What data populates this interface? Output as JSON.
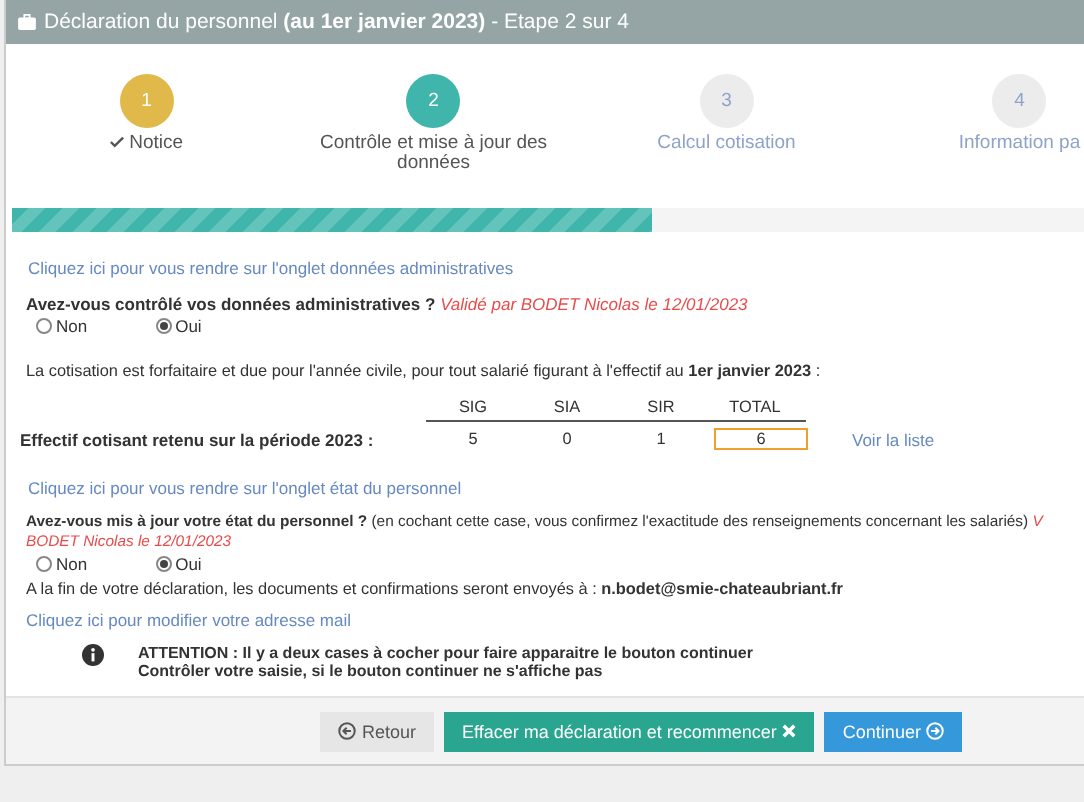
{
  "window": {
    "title": "Déclaration du personnel **(au 1er janvier 2023)** - Etape 2 sur 4"
  },
  "steps": [
    {
      "number": "1",
      "label": "Notice",
      "completed": true,
      "selected": false
    },
    {
      "number": "2",
      "label": "Contrôle et mise à jour des données",
      "completed": false,
      "selected": true
    },
    {
      "number": "3",
      "label": "Calcul cotisation",
      "completed": false,
      "selected": false
    },
    {
      "number": "4",
      "label": "Information pa",
      "completed": false,
      "selected": false
    }
  ],
  "progress": {
    "level": 0.555
  },
  "section1": {
    "link": "Cliquez ici pour vous rendre sur l'onglet données administratives",
    "question": "Avez-vous contrôlé vos données administratives ?",
    "validation": "Validé par BODET Nicolas le 12/01/2023",
    "options": [
      {
        "label": "Non",
        "selected": false
      },
      {
        "label": "Oui",
        "selected": true
      }
    ]
  },
  "info": "La cotisation est forfaitaire et due pour l'année civile, pour tout salarié figurant à l'effectif au **1er janvier 2023** :",
  "table": {
    "columns": [
      "SIG",
      "SIA",
      "SIR",
      "TOTAL"
    ],
    "row_label": "Effectif cotisant retenu sur la période 2023 :",
    "values": [
      "5",
      "0",
      "1",
      "6"
    ],
    "link": "Voir la liste"
  },
  "section2": {
    "link": "Cliquez ici pour vous rendre sur l'onglet état du personnel",
    "question": "Avez-vous mis à jour votre état du personnel ?",
    "note": "(en cochant cette case, vous confirmez l'exactitude des renseignements concernant les salariés)",
    "validation_start": "V",
    "validation": "BODET Nicolas le 12/01/2023",
    "options": [
      {
        "label": "Non",
        "selected": false
      },
      {
        "label": "Oui",
        "selected": true
      }
    ]
  },
  "email_text": "A la fin de votre déclaration, les documents et confirmations seront envoyés à : **n.bodet@smie-chateaubriant.fr**",
  "email_link": "Cliquez ici pour modifier votre adresse mail",
  "warning": [
    "ATTENTION : Il y a deux cases à cocher pour faire apparaitre le bouton continuer",
    "Contrôler votre saisie, si le bouton continuer ne s'affiche pas"
  ],
  "buttons": [
    {
      "label": "Retour",
      "kind": "back"
    },
    {
      "label": "Effacer ma déclaration et recommencer",
      "kind": "reset"
    },
    {
      "label": "Continuer",
      "kind": "next"
    }
  ]
}
